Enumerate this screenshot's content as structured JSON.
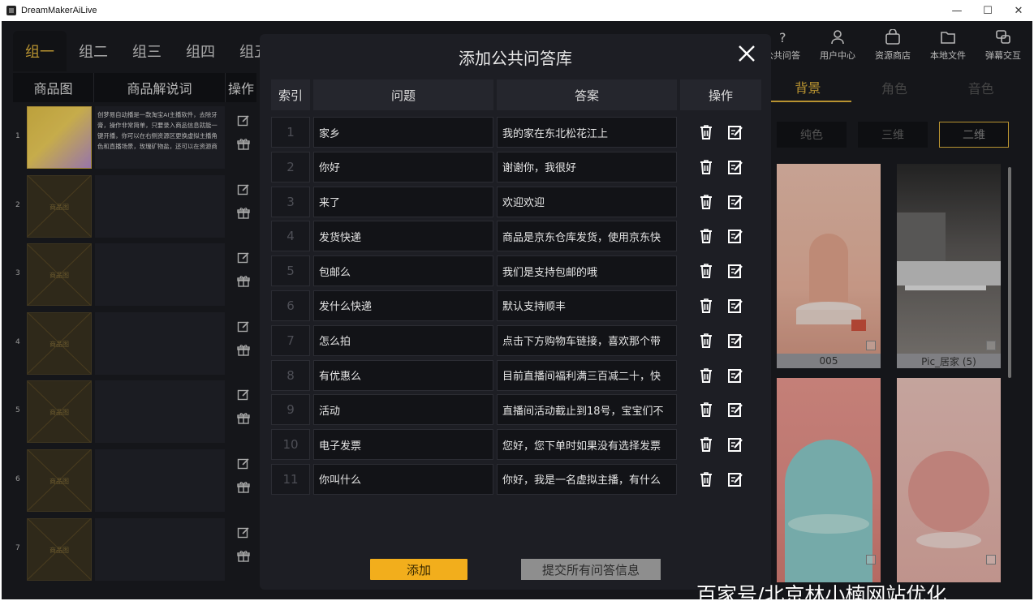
{
  "window": {
    "title": "DreamMakerAiLive"
  },
  "groups": [
    "组一",
    "组二",
    "组三",
    "组四",
    "组五"
  ],
  "left_table": {
    "headers": {
      "image": "商品图",
      "desc": "商品解说词",
      "op": "操作"
    },
    "rows": [
      {
        "idx": "1",
        "desc": "创梦易自动播是一款淘宝AI主播软件，去除牙膏，操作非常简单，只要录入商品信息就能一键开播，你可以在右侧资源区更换虚拟主播角色和直播场景，玫瑰矿物盐，还可以在资源商",
        "thumb": ""
      },
      {
        "idx": "2",
        "desc": "",
        "thumb": "商品图"
      },
      {
        "idx": "3",
        "desc": "",
        "thumb": "商品图"
      },
      {
        "idx": "4",
        "desc": "",
        "thumb": "商品图"
      },
      {
        "idx": "5",
        "desc": "",
        "thumb": "商品图"
      },
      {
        "idx": "6",
        "desc": "",
        "thumb": "商品图"
      },
      {
        "idx": "7",
        "desc": "",
        "thumb": "商品图"
      }
    ]
  },
  "toolbar": [
    {
      "label": "公共问答",
      "icon": "question-icon"
    },
    {
      "label": "用户中心",
      "icon": "user-icon"
    },
    {
      "label": "资源商店",
      "icon": "shop-bag-icon"
    },
    {
      "label": "本地文件",
      "icon": "folder-icon"
    },
    {
      "label": "弹幕交互",
      "icon": "chat-icon"
    }
  ],
  "right_tabs": [
    "背景",
    "角色",
    "音色"
  ],
  "style_buttons": [
    "纯色",
    "三维",
    "二维"
  ],
  "gallery": [
    {
      "caption": "005"
    },
    {
      "caption": "Pic_居家 (5)"
    },
    {
      "caption": ""
    },
    {
      "caption": ""
    }
  ],
  "modal": {
    "title": "添加公共问答库",
    "headers": {
      "index": "索引",
      "question": "问题",
      "answer": "答案",
      "op": "操作"
    },
    "rows": [
      {
        "index": "1",
        "question": "家乡",
        "answer": "我的家在东北松花江上"
      },
      {
        "index": "2",
        "question": "你好",
        "answer": "谢谢你，我很好"
      },
      {
        "index": "3",
        "question": "来了",
        "answer": "欢迎欢迎"
      },
      {
        "index": "4",
        "question": "发货快递",
        "answer": "商品是京东仓库发货，使用京东快"
      },
      {
        "index": "5",
        "question": "包邮么",
        "answer": "我们是支持包邮的哦"
      },
      {
        "index": "6",
        "question": "发什么快递",
        "answer": "默认支持顺丰"
      },
      {
        "index": "7",
        "question": "怎么拍",
        "answer": "点击下方购物车链接，喜欢那个带"
      },
      {
        "index": "8",
        "question": "有优惠么",
        "answer": "目前直播间福利满三百减二十，快"
      },
      {
        "index": "9",
        "question": "活动",
        "answer": "直播间活动截止到18号，宝宝们不"
      },
      {
        "index": "10",
        "question": "电子发票",
        "answer": "您好，您下单时如果没有选择发票"
      },
      {
        "index": "11",
        "question": "你叫什么",
        "answer": "你好，我是一名虚拟主播，有什么"
      }
    ],
    "add_label": "添加",
    "submit_label": "提交所有问答信息"
  },
  "watermark": "百家号/北京林小楠网站优化",
  "colors": {
    "accent": "#e1b43c",
    "add_button": "#f2ae1c",
    "panel": "#1d1e24"
  }
}
